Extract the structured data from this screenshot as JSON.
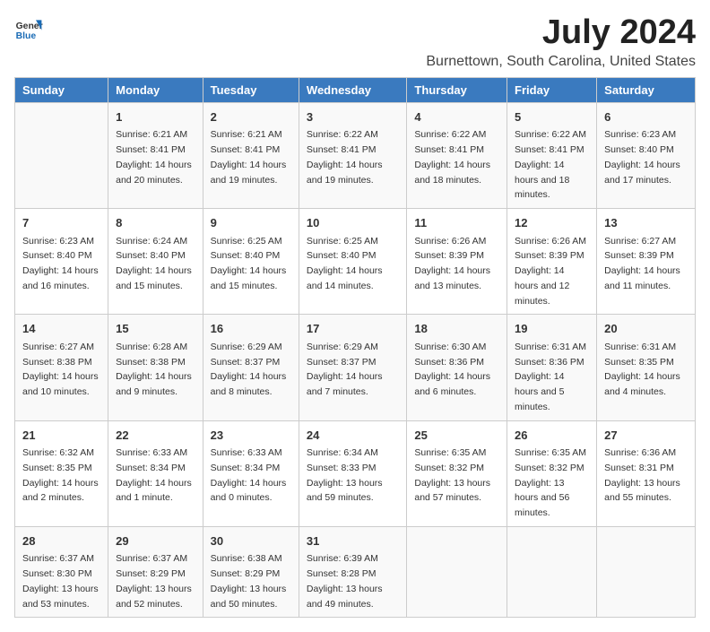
{
  "header": {
    "logo_general": "General",
    "logo_blue": "Blue",
    "main_title": "July 2024",
    "subtitle": "Burnettown, South Carolina, United States"
  },
  "calendar": {
    "days_of_week": [
      "Sunday",
      "Monday",
      "Tuesday",
      "Wednesday",
      "Thursday",
      "Friday",
      "Saturday"
    ],
    "weeks": [
      [
        {
          "day": "",
          "sunrise": "",
          "sunset": "",
          "daylight": ""
        },
        {
          "day": "1",
          "sunrise": "Sunrise: 6:21 AM",
          "sunset": "Sunset: 8:41 PM",
          "daylight": "Daylight: 14 hours and 20 minutes."
        },
        {
          "day": "2",
          "sunrise": "Sunrise: 6:21 AM",
          "sunset": "Sunset: 8:41 PM",
          "daylight": "Daylight: 14 hours and 19 minutes."
        },
        {
          "day": "3",
          "sunrise": "Sunrise: 6:22 AM",
          "sunset": "Sunset: 8:41 PM",
          "daylight": "Daylight: 14 hours and 19 minutes."
        },
        {
          "day": "4",
          "sunrise": "Sunrise: 6:22 AM",
          "sunset": "Sunset: 8:41 PM",
          "daylight": "Daylight: 14 hours and 18 minutes."
        },
        {
          "day": "5",
          "sunrise": "Sunrise: 6:22 AM",
          "sunset": "Sunset: 8:41 PM",
          "daylight": "Daylight: 14 hours and 18 minutes."
        },
        {
          "day": "6",
          "sunrise": "Sunrise: 6:23 AM",
          "sunset": "Sunset: 8:40 PM",
          "daylight": "Daylight: 14 hours and 17 minutes."
        }
      ],
      [
        {
          "day": "7",
          "sunrise": "Sunrise: 6:23 AM",
          "sunset": "Sunset: 8:40 PM",
          "daylight": "Daylight: 14 hours and 16 minutes."
        },
        {
          "day": "8",
          "sunrise": "Sunrise: 6:24 AM",
          "sunset": "Sunset: 8:40 PM",
          "daylight": "Daylight: 14 hours and 15 minutes."
        },
        {
          "day": "9",
          "sunrise": "Sunrise: 6:25 AM",
          "sunset": "Sunset: 8:40 PM",
          "daylight": "Daylight: 14 hours and 15 minutes."
        },
        {
          "day": "10",
          "sunrise": "Sunrise: 6:25 AM",
          "sunset": "Sunset: 8:40 PM",
          "daylight": "Daylight: 14 hours and 14 minutes."
        },
        {
          "day": "11",
          "sunrise": "Sunrise: 6:26 AM",
          "sunset": "Sunset: 8:39 PM",
          "daylight": "Daylight: 14 hours and 13 minutes."
        },
        {
          "day": "12",
          "sunrise": "Sunrise: 6:26 AM",
          "sunset": "Sunset: 8:39 PM",
          "daylight": "Daylight: 14 hours and 12 minutes."
        },
        {
          "day": "13",
          "sunrise": "Sunrise: 6:27 AM",
          "sunset": "Sunset: 8:39 PM",
          "daylight": "Daylight: 14 hours and 11 minutes."
        }
      ],
      [
        {
          "day": "14",
          "sunrise": "Sunrise: 6:27 AM",
          "sunset": "Sunset: 8:38 PM",
          "daylight": "Daylight: 14 hours and 10 minutes."
        },
        {
          "day": "15",
          "sunrise": "Sunrise: 6:28 AM",
          "sunset": "Sunset: 8:38 PM",
          "daylight": "Daylight: 14 hours and 9 minutes."
        },
        {
          "day": "16",
          "sunrise": "Sunrise: 6:29 AM",
          "sunset": "Sunset: 8:37 PM",
          "daylight": "Daylight: 14 hours and 8 minutes."
        },
        {
          "day": "17",
          "sunrise": "Sunrise: 6:29 AM",
          "sunset": "Sunset: 8:37 PM",
          "daylight": "Daylight: 14 hours and 7 minutes."
        },
        {
          "day": "18",
          "sunrise": "Sunrise: 6:30 AM",
          "sunset": "Sunset: 8:36 PM",
          "daylight": "Daylight: 14 hours and 6 minutes."
        },
        {
          "day": "19",
          "sunrise": "Sunrise: 6:31 AM",
          "sunset": "Sunset: 8:36 PM",
          "daylight": "Daylight: 14 hours and 5 minutes."
        },
        {
          "day": "20",
          "sunrise": "Sunrise: 6:31 AM",
          "sunset": "Sunset: 8:35 PM",
          "daylight": "Daylight: 14 hours and 4 minutes."
        }
      ],
      [
        {
          "day": "21",
          "sunrise": "Sunrise: 6:32 AM",
          "sunset": "Sunset: 8:35 PM",
          "daylight": "Daylight: 14 hours and 2 minutes."
        },
        {
          "day": "22",
          "sunrise": "Sunrise: 6:33 AM",
          "sunset": "Sunset: 8:34 PM",
          "daylight": "Daylight: 14 hours and 1 minute."
        },
        {
          "day": "23",
          "sunrise": "Sunrise: 6:33 AM",
          "sunset": "Sunset: 8:34 PM",
          "daylight": "Daylight: 14 hours and 0 minutes."
        },
        {
          "day": "24",
          "sunrise": "Sunrise: 6:34 AM",
          "sunset": "Sunset: 8:33 PM",
          "daylight": "Daylight: 13 hours and 59 minutes."
        },
        {
          "day": "25",
          "sunrise": "Sunrise: 6:35 AM",
          "sunset": "Sunset: 8:32 PM",
          "daylight": "Daylight: 13 hours and 57 minutes."
        },
        {
          "day": "26",
          "sunrise": "Sunrise: 6:35 AM",
          "sunset": "Sunset: 8:32 PM",
          "daylight": "Daylight: 13 hours and 56 minutes."
        },
        {
          "day": "27",
          "sunrise": "Sunrise: 6:36 AM",
          "sunset": "Sunset: 8:31 PM",
          "daylight": "Daylight: 13 hours and 55 minutes."
        }
      ],
      [
        {
          "day": "28",
          "sunrise": "Sunrise: 6:37 AM",
          "sunset": "Sunset: 8:30 PM",
          "daylight": "Daylight: 13 hours and 53 minutes."
        },
        {
          "day": "29",
          "sunrise": "Sunrise: 6:37 AM",
          "sunset": "Sunset: 8:29 PM",
          "daylight": "Daylight: 13 hours and 52 minutes."
        },
        {
          "day": "30",
          "sunrise": "Sunrise: 6:38 AM",
          "sunset": "Sunset: 8:29 PM",
          "daylight": "Daylight: 13 hours and 50 minutes."
        },
        {
          "day": "31",
          "sunrise": "Sunrise: 6:39 AM",
          "sunset": "Sunset: 8:28 PM",
          "daylight": "Daylight: 13 hours and 49 minutes."
        },
        {
          "day": "",
          "sunrise": "",
          "sunset": "",
          "daylight": ""
        },
        {
          "day": "",
          "sunrise": "",
          "sunset": "",
          "daylight": ""
        },
        {
          "day": "",
          "sunrise": "",
          "sunset": "",
          "daylight": ""
        }
      ]
    ]
  }
}
